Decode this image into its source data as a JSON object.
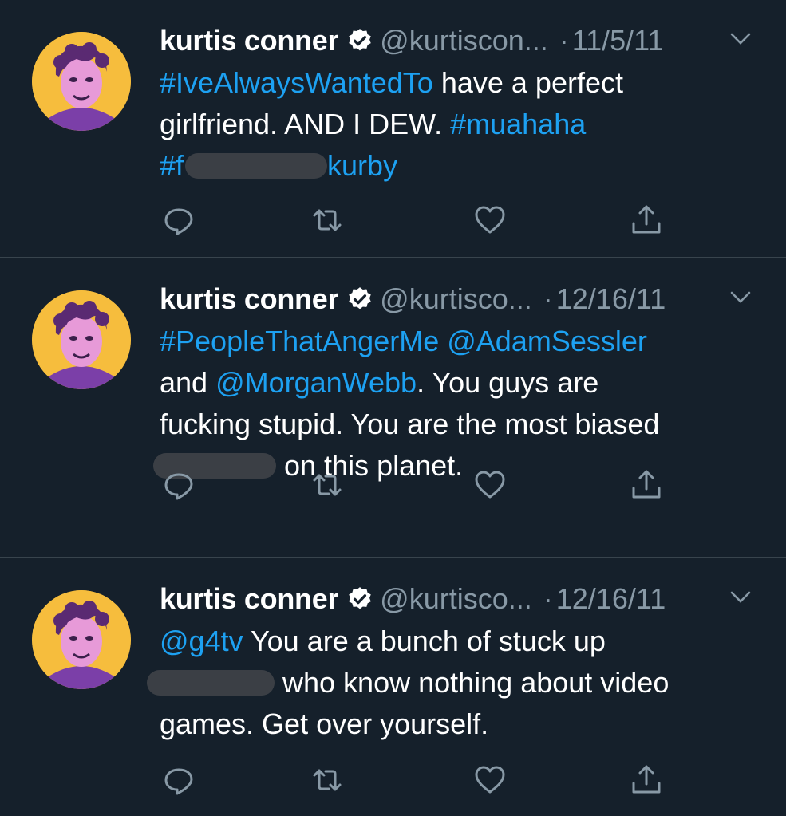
{
  "colors": {
    "background": "#15202b",
    "divider": "#38444d",
    "link": "#1da1f2",
    "muted": "#8899a6",
    "avatar_bg": "#f6bd3d",
    "redaction": "#3b3f45"
  },
  "icons": {
    "verified": "verified-badge-icon",
    "menu": "chevron-down-icon",
    "reply": "reply-icon",
    "retweet": "retweet-icon",
    "like": "heart-icon",
    "share": "share-icon"
  },
  "tweets": [
    {
      "name": "kurtis conner",
      "handle": "@kurtiscon...",
      "dot": "·",
      "date": "11/5/11",
      "line1": {
        "tag": "#IveAlwaysWantedTo",
        "text": " have a perfect"
      },
      "line2": {
        "text": "girlfriend. AND I DEW. ",
        "tag": "#muahaha"
      },
      "line3": {
        "tag_start": "#f",
        "tag_end": "kurby"
      }
    },
    {
      "name": "kurtis conner",
      "handle": "@kurtisco...",
      "dot": "·",
      "date": "12/16/11",
      "line1": {
        "tag": "#PeopleThatAngerMe",
        "mention": "@AdamSessler"
      },
      "line2": {
        "pre": "and ",
        "mention": "@MorganWebb",
        "text": ". You guys are"
      },
      "line3": {
        "text": "fucking stupid. You are the most biased"
      },
      "line4": {
        "text": "on this planet."
      }
    },
    {
      "name": "kurtis conner",
      "handle": "@kurtisco...",
      "dot": "·",
      "date": "12/16/11",
      "line1": {
        "mention": "@g4tv",
        "text": " You are a bunch of stuck up"
      },
      "line2": {
        "text": "who know nothing about video"
      },
      "line3": {
        "text": "games. Get over yourself."
      }
    }
  ]
}
